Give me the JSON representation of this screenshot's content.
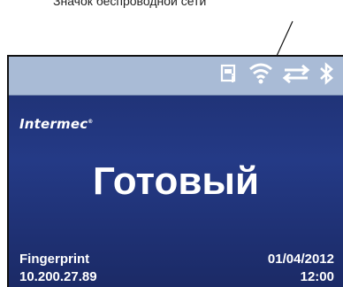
{
  "callout": {
    "label": "Значок беспроводной сети"
  },
  "status_bar": {
    "icons": [
      "printer-info-icon",
      "wifi-icon",
      "transfer-arrows-icon",
      "bluetooth-icon"
    ]
  },
  "brand": {
    "name": "Intermec",
    "trademark": "®"
  },
  "main": {
    "status": "Готовый"
  },
  "info": {
    "app_name": "Fingerprint",
    "ip_address": "10.200.27.89",
    "date": "01/04/2012",
    "time": "12:00"
  },
  "colors": {
    "screen_top": "#1e2f6f",
    "screen_mid": "#243a86",
    "status_bar": "#a9bbd6",
    "text": "#ffffff"
  }
}
